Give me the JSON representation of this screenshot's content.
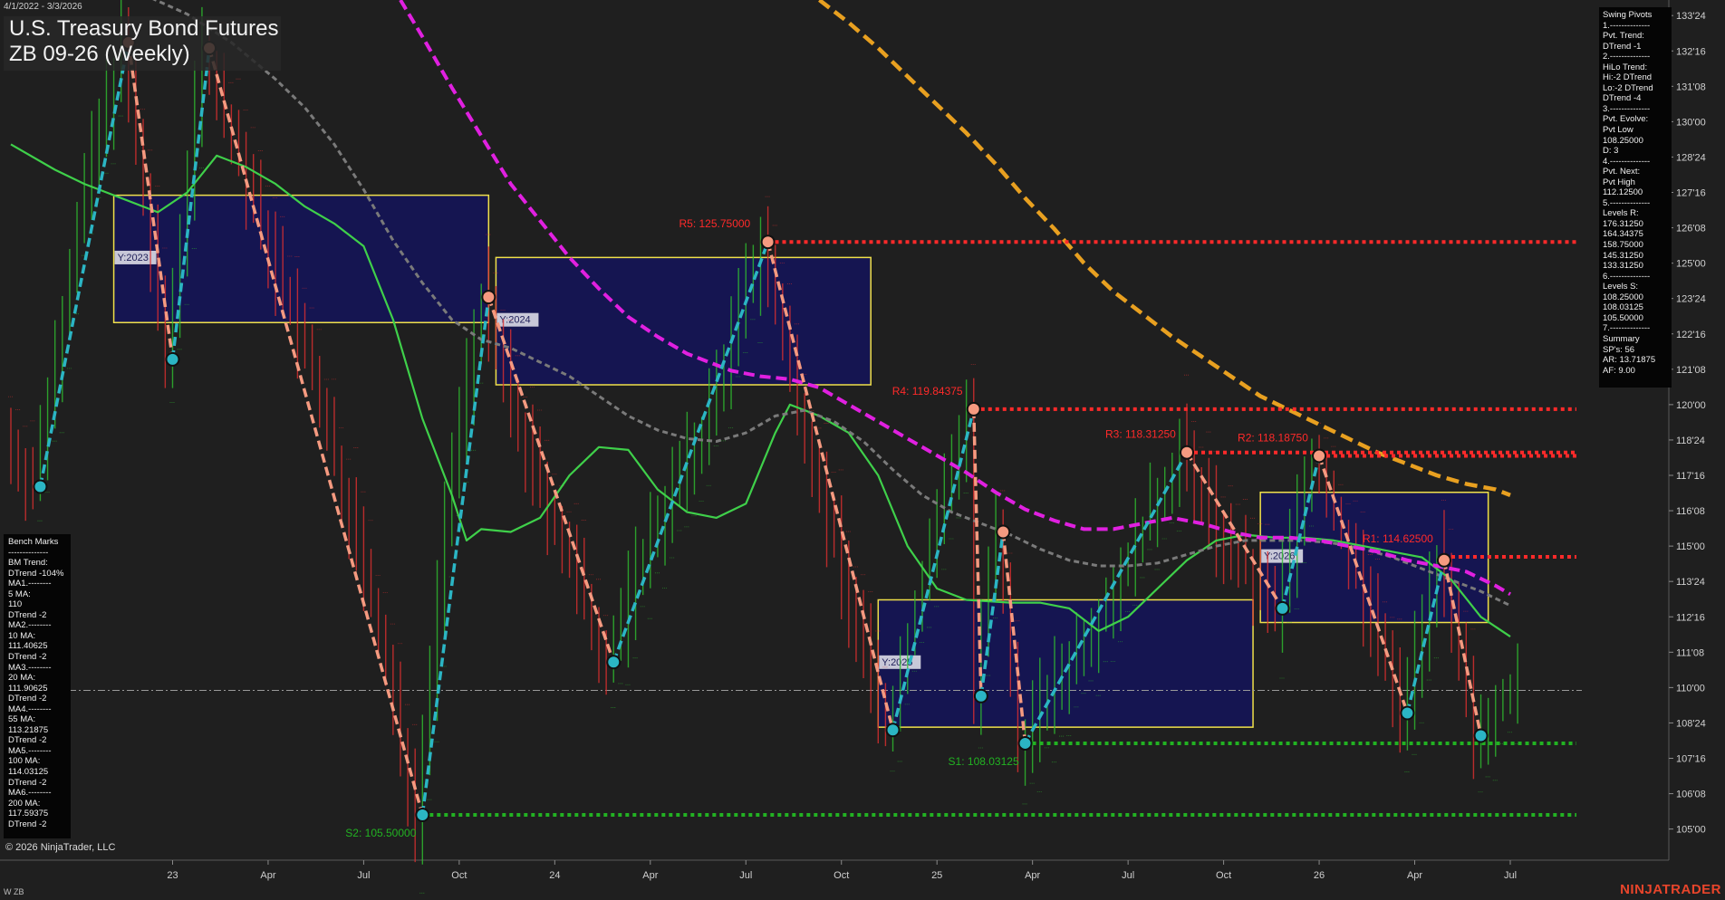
{
  "header": {
    "date_range": "4/1/2022 - 3/3/2026",
    "title_line1": "U.S. Treasury Bond Futures",
    "title_line2": "ZB 09-26 (Weekly)"
  },
  "footer": {
    "copyright": "© 2026 NinjaTrader, LLC",
    "symbol_tag": "W ZB",
    "brand": "NINJATRADER"
  },
  "swing_pivots_panel": [
    "Swing Pivots",
    "1.--------------",
    "Pvt. Trend:",
    "DTrend -1",
    "2.--------------",
    "HiLo Trend:",
    "Hi:-2 DTrend",
    "Lo:-2 DTrend",
    "DTrend -4",
    "3.--------------",
    "Pvt. Evolve:",
    "Pvt Low",
    "108.25000",
    "D: 3",
    "4.--------------",
    "Pvt. Next:",
    "Pvt High",
    "112.12500",
    "5.--------------",
    "Levels R:",
    "176.31250",
    "164.34375",
    "158.75000",
    "145.31250",
    "133.31250",
    "6.--------------",
    "Levels S:",
    "108.25000",
    "108.03125",
    "105.50000",
    "7.--------------",
    "Summary",
    "SP's: 56",
    "AR: 13.71875",
    "AF: 9.00"
  ],
  "bench_marks_panel": [
    "Bench Marks",
    "--------------",
    "BM Trend:",
    "DTrend -104%",
    "MA1.--------",
    "5 MA:",
    "110",
    "DTrend -2",
    "MA2.--------",
    "10 MA:",
    "111.40625",
    "DTrend -2",
    "MA3.--------",
    "20 MA:",
    "111.90625",
    "DTrend -2",
    "MA4.--------",
    "55 MA:",
    "113.21875",
    "DTrend -2",
    "MA5.--------",
    "100 MA:",
    "114.03125",
    "DTrend -2",
    "MA6.--------",
    "200 MA:",
    "117.59375",
    "DTrend -2"
  ],
  "colors": {
    "background": "#1f1f1f",
    "bull_bar": "#2fbf2f",
    "bear_bar": "#e03030",
    "zone_fill": "#14145a",
    "zone_border": "#f0e04a",
    "resistance": "#ff2a2a",
    "support": "#22b222",
    "swing_up": "#2bb5c4",
    "swing_down": "#f59a80",
    "ma_green": "#3fd04a",
    "ma_gray": "#7a7a7a",
    "ma_magenta": "#e020e0",
    "ma_orange": "#e8a020"
  },
  "chart_data": {
    "type": "line",
    "title": "U.S. Treasury Bond Futures",
    "subtitle": "ZB 09-26 (Weekly)",
    "ylim": [
      103.9,
      134.3
    ],
    "y_ticks": [
      "133'24",
      "132'16",
      "131'08",
      "130'00",
      "128'24",
      "127'16",
      "126'08",
      "125'00",
      "123'24",
      "122'16",
      "121'08",
      "120'00",
      "118'24",
      "117'16",
      "116'08",
      "115'00",
      "113'24",
      "112'16",
      "111'08",
      "110'00",
      "108'24",
      "107'16",
      "106'08",
      "105'00"
    ],
    "x_ticks": [
      {
        "label": "23",
        "i": 22
      },
      {
        "label": "Apr",
        "i": 35
      },
      {
        "label": "Jul",
        "i": 48
      },
      {
        "label": "Oct",
        "i": 61
      },
      {
        "label": "24",
        "i": 74
      },
      {
        "label": "Apr",
        "i": 87
      },
      {
        "label": "Jul",
        "i": 100
      },
      {
        "label": "Oct",
        "i": 113
      },
      {
        "label": "25",
        "i": 126
      },
      {
        "label": "Apr",
        "i": 139
      },
      {
        "label": "Jul",
        "i": 152
      },
      {
        "label": "Oct",
        "i": 165
      },
      {
        "label": "26",
        "i": 178
      },
      {
        "label": "Apr",
        "i": 191
      },
      {
        "label": "Jul",
        "i": 204
      }
    ],
    "bar_count": 214,
    "current_price_line": 109.9,
    "levels": [
      {
        "name": "R5",
        "label": "R5: 125.75000",
        "value": 125.75,
        "start_i": 102,
        "kind": "resistance"
      },
      {
        "name": "R4",
        "label": "R4: 119.84375",
        "value": 119.84,
        "start_i": 131,
        "kind": "resistance"
      },
      {
        "name": "R3",
        "label": "R3: 118.31250",
        "value": 118.31,
        "start_i": 160,
        "kind": "resistance"
      },
      {
        "name": "R2",
        "label": "R2: 118.18750",
        "value": 118.19,
        "start_i": 178,
        "kind": "resistance"
      },
      {
        "name": "R1",
        "label": "R1: 114.62500",
        "value": 114.62,
        "start_i": 195,
        "kind": "resistance"
      },
      {
        "name": "S1",
        "label": "S1: 108.03125",
        "value": 108.03,
        "start_i": 138,
        "kind": "support"
      },
      {
        "name": "S2",
        "label": "S2: 105.50000",
        "value": 105.5,
        "start_i": 56,
        "kind": "support"
      }
    ],
    "year_zones": [
      {
        "label": "Y:2023",
        "i0": 14,
        "i1": 65,
        "top": 127.4,
        "bottom": 122.9
      },
      {
        "label": "Y:2024",
        "i0": 66,
        "i1": 117,
        "top": 125.2,
        "bottom": 120.7
      },
      {
        "label": "Y:2025",
        "i0": 118,
        "i1": 169,
        "top": 113.1,
        "bottom": 108.6
      },
      {
        "label": "Y:2026",
        "i0": 170,
        "i1": 201,
        "top": 116.9,
        "bottom": 112.3
      }
    ],
    "swing_points": [
      {
        "i": 4,
        "v": 117.1,
        "t": "L"
      },
      {
        "i": 16,
        "v": 132.8,
        "t": "H"
      },
      {
        "i": 22,
        "v": 121.6,
        "t": "L"
      },
      {
        "i": 27,
        "v": 132.6,
        "t": "H"
      },
      {
        "i": 56,
        "v": 105.5,
        "t": "L"
      },
      {
        "i": 65,
        "v": 123.8,
        "t": "H"
      },
      {
        "i": 82,
        "v": 110.9,
        "t": "L"
      },
      {
        "i": 103,
        "v": 125.75,
        "t": "H"
      },
      {
        "i": 120,
        "v": 108.5,
        "t": "L"
      },
      {
        "i": 131,
        "v": 119.84,
        "t": "H"
      },
      {
        "i": 132,
        "v": 109.7,
        "t": "L"
      },
      {
        "i": 135,
        "v": 115.5,
        "t": "H"
      },
      {
        "i": 138,
        "v": 108.03,
        "t": "L"
      },
      {
        "i": 160,
        "v": 118.31,
        "t": "H"
      },
      {
        "i": 173,
        "v": 112.8,
        "t": "L"
      },
      {
        "i": 178,
        "v": 118.19,
        "t": "H"
      },
      {
        "i": 190,
        "v": 109.1,
        "t": "L"
      },
      {
        "i": 195,
        "v": 114.5,
        "t": "H"
      },
      {
        "i": 200,
        "v": 108.3,
        "t": "L"
      }
    ],
    "series": [
      {
        "color": "ma_green",
        "dash": "",
        "width": 2.2,
        "points": [
          [
            0,
            129.2
          ],
          [
            6,
            128.3
          ],
          [
            10,
            127.8
          ],
          [
            14,
            127.4
          ],
          [
            20,
            126.8
          ],
          [
            24,
            127.5
          ],
          [
            28,
            128.8
          ],
          [
            32,
            128.4
          ],
          [
            36,
            127.8
          ],
          [
            40,
            127.0
          ],
          [
            44,
            126.4
          ],
          [
            48,
            125.6
          ],
          [
            52,
            123.0
          ],
          [
            56,
            119.5
          ],
          [
            60,
            116.8
          ],
          [
            62,
            115.2
          ],
          [
            64,
            115.6
          ],
          [
            68,
            115.5
          ],
          [
            72,
            116.0
          ],
          [
            76,
            117.5
          ],
          [
            80,
            118.5
          ],
          [
            84,
            118.4
          ],
          [
            88,
            117.0
          ],
          [
            92,
            116.2
          ],
          [
            96,
            116.0
          ],
          [
            100,
            116.5
          ],
          [
            104,
            119.0
          ],
          [
            106,
            120.0
          ],
          [
            110,
            119.6
          ],
          [
            114,
            119.0
          ],
          [
            118,
            117.5
          ],
          [
            122,
            115.0
          ],
          [
            126,
            113.5
          ],
          [
            130,
            113.1
          ],
          [
            136,
            113.0
          ],
          [
            140,
            113.0
          ],
          [
            144,
            112.8
          ],
          [
            148,
            112.0
          ],
          [
            152,
            112.5
          ],
          [
            156,
            113.5
          ],
          [
            160,
            114.5
          ],
          [
            164,
            115.2
          ],
          [
            168,
            115.4
          ],
          [
            172,
            115.3
          ],
          [
            176,
            115.3
          ],
          [
            180,
            115.2
          ],
          [
            184,
            115.0
          ],
          [
            188,
            114.8
          ],
          [
            192,
            114.6
          ],
          [
            196,
            113.8
          ],
          [
            200,
            112.5
          ],
          [
            204,
            111.8
          ]
        ]
      },
      {
        "color": "ma_gray",
        "dash": "6,4",
        "width": 3,
        "points": [
          [
            18,
            134.5
          ],
          [
            24,
            133.8
          ],
          [
            30,
            132.8
          ],
          [
            36,
            131.5
          ],
          [
            40,
            130.5
          ],
          [
            44,
            129.2
          ],
          [
            48,
            127.6
          ],
          [
            52,
            125.8
          ],
          [
            56,
            124.3
          ],
          [
            60,
            123.0
          ],
          [
            64,
            122.3
          ],
          [
            68,
            122.0
          ],
          [
            72,
            121.5
          ],
          [
            76,
            121.0
          ],
          [
            80,
            120.3
          ],
          [
            84,
            119.6
          ],
          [
            88,
            119.1
          ],
          [
            92,
            118.8
          ],
          [
            96,
            118.7
          ],
          [
            100,
            119.0
          ],
          [
            104,
            119.6
          ],
          [
            108,
            119.8
          ],
          [
            112,
            119.4
          ],
          [
            116,
            118.7
          ],
          [
            120,
            117.7
          ],
          [
            124,
            116.8
          ],
          [
            128,
            116.2
          ],
          [
            132,
            115.8
          ],
          [
            136,
            115.4
          ],
          [
            140,
            114.9
          ],
          [
            144,
            114.5
          ],
          [
            148,
            114.3
          ],
          [
            152,
            114.3
          ],
          [
            156,
            114.4
          ],
          [
            160,
            114.7
          ],
          [
            164,
            115.0
          ],
          [
            168,
            115.2
          ],
          [
            172,
            115.2
          ],
          [
            176,
            115.2
          ],
          [
            180,
            115.1
          ],
          [
            184,
            114.9
          ],
          [
            188,
            114.6
          ],
          [
            192,
            114.2
          ],
          [
            196,
            113.8
          ],
          [
            200,
            113.4
          ],
          [
            204,
            112.9
          ]
        ]
      },
      {
        "color": "ma_magenta",
        "dash": "12,6",
        "width": 4,
        "points": [
          [
            53,
            134.3
          ],
          [
            56,
            133.0
          ],
          [
            60,
            131.2
          ],
          [
            64,
            129.5
          ],
          [
            68,
            127.8
          ],
          [
            72,
            126.5
          ],
          [
            76,
            125.2
          ],
          [
            80,
            124.1
          ],
          [
            84,
            123.1
          ],
          [
            88,
            122.4
          ],
          [
            92,
            121.8
          ],
          [
            96,
            121.4
          ],
          [
            98,
            121.2
          ],
          [
            102,
            121.0
          ],
          [
            106,
            120.9
          ],
          [
            110,
            120.6
          ],
          [
            114,
            120.0
          ],
          [
            118,
            119.4
          ],
          [
            122,
            118.8
          ],
          [
            126,
            118.2
          ],
          [
            130,
            117.6
          ],
          [
            134,
            116.9
          ],
          [
            138,
            116.3
          ],
          [
            142,
            115.9
          ],
          [
            146,
            115.6
          ],
          [
            150,
            115.6
          ],
          [
            154,
            115.8
          ],
          [
            158,
            116.0
          ],
          [
            162,
            115.8
          ],
          [
            166,
            115.5
          ],
          [
            170,
            115.3
          ],
          [
            174,
            115.3
          ],
          [
            178,
            115.2
          ],
          [
            182,
            115.0
          ],
          [
            186,
            114.8
          ],
          [
            190,
            114.5
          ],
          [
            194,
            114.3
          ],
          [
            198,
            114.1
          ],
          [
            202,
            113.6
          ],
          [
            204,
            113.3
          ]
        ]
      },
      {
        "color": "ma_orange",
        "dash": "14,7",
        "width": 4.5,
        "points": [
          [
            110,
            134.3
          ],
          [
            114,
            133.5
          ],
          [
            118,
            132.6
          ],
          [
            122,
            131.6
          ],
          [
            126,
            130.6
          ],
          [
            130,
            129.6
          ],
          [
            134,
            128.5
          ],
          [
            138,
            127.3
          ],
          [
            142,
            126.2
          ],
          [
            146,
            125.0
          ],
          [
            150,
            124.0
          ],
          [
            154,
            123.2
          ],
          [
            158,
            122.4
          ],
          [
            162,
            121.7
          ],
          [
            166,
            121.0
          ],
          [
            170,
            120.3
          ],
          [
            174,
            119.8
          ],
          [
            178,
            119.3
          ],
          [
            182,
            118.8
          ],
          [
            186,
            118.3
          ],
          [
            190,
            117.9
          ],
          [
            194,
            117.5
          ],
          [
            198,
            117.2
          ],
          [
            202,
            117.0
          ],
          [
            204,
            116.8
          ]
        ]
      }
    ],
    "price_path": [
      [
        0,
        118.8
      ],
      [
        4,
        117.1
      ],
      [
        10,
        126.5
      ],
      [
        16,
        132.8
      ],
      [
        22,
        121.6
      ],
      [
        27,
        132.6
      ],
      [
        34,
        127.0
      ],
      [
        42,
        121.0
      ],
      [
        50,
        113.0
      ],
      [
        56,
        105.5
      ],
      [
        61,
        118.0
      ],
      [
        65,
        123.8
      ],
      [
        70,
        119.0
      ],
      [
        76,
        115.0
      ],
      [
        82,
        110.9
      ],
      [
        88,
        115.5
      ],
      [
        95,
        119.0
      ],
      [
        103,
        125.75
      ],
      [
        108,
        120.0
      ],
      [
        114,
        114.0
      ],
      [
        120,
        108.5
      ],
      [
        126,
        115.0
      ],
      [
        131,
        119.84
      ],
      [
        132,
        109.7
      ],
      [
        135,
        115.5
      ],
      [
        138,
        108.03
      ],
      [
        145,
        111.0
      ],
      [
        152,
        114.0
      ],
      [
        160,
        118.31
      ],
      [
        166,
        115.0
      ],
      [
        173,
        112.8
      ],
      [
        178,
        118.19
      ],
      [
        184,
        114.0
      ],
      [
        190,
        109.1
      ],
      [
        195,
        114.5
      ],
      [
        200,
        108.3
      ],
      [
        204,
        109.9
      ]
    ]
  }
}
